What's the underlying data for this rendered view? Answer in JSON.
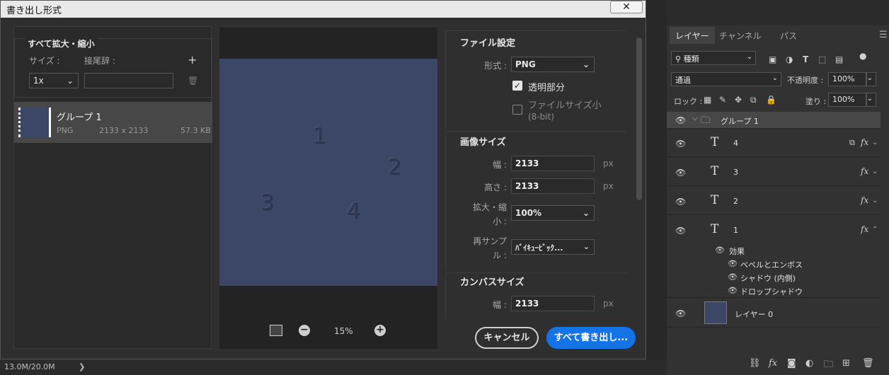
{
  "dialog": {
    "title": "書き出し形式",
    "close": "✕",
    "scale_section": {
      "title": "すべて拡大・縮小",
      "size_label": "サイズ :",
      "suffix_label": "接尾辞 :",
      "add": "+",
      "size_value": "1x"
    },
    "asset": {
      "name": "グループ 1",
      "format": "PNG",
      "dimensions": "2133 x 2133",
      "filesize": "57.3 KB"
    },
    "preview": {
      "numbers": [
        "1",
        "2",
        "3",
        "4"
      ],
      "zoom": "15%",
      "zoom_out": "−",
      "zoom_in": "+"
    },
    "file_settings": {
      "title": "ファイル設定",
      "format_label": "形式 :",
      "format_value": "PNG",
      "transparency_label": "透明部分",
      "transparency_checked": true,
      "smaller_file_label": "ファイルサイズ小",
      "smaller_file_sub": "(8-bit)",
      "smaller_file_checked": false
    },
    "image_size": {
      "title": "画像サイズ",
      "width_label": "幅 :",
      "width_value": "2133",
      "height_label": "高さ :",
      "height_value": "2133",
      "unit": "px",
      "scale_label_1": "拡大・縮",
      "scale_label_2": "小 :",
      "scale_value": "100%",
      "resample_label_1": "再サンプ",
      "resample_label_2": "ル :",
      "resample_value": "ﾊﾞｲｷｭｰﾋﾞｯｸ..."
    },
    "canvas_size": {
      "title": "カンバスサイズ",
      "width_label": "幅 :",
      "width_value": "2133",
      "unit": "px"
    },
    "buttons": {
      "cancel": "キャンセル",
      "export": "すべて書き出し..."
    }
  },
  "status": {
    "text": "13.0M/20.0M",
    "arrow": "❯"
  },
  "layers_panel": {
    "tabs": [
      "レイヤー",
      "チャンネル",
      "パス"
    ],
    "filter_label": "種類",
    "blend_mode": "通過",
    "opacity_label": "不透明度 :",
    "opacity_value": "100%",
    "lock_label": "ロック :",
    "fill_label": "塗り :",
    "fill_value": "100%",
    "group_name": "グループ 1",
    "layers": [
      {
        "name": "4",
        "fx": "fx"
      },
      {
        "name": "3",
        "fx": "fx"
      },
      {
        "name": "2",
        "fx": "fx"
      },
      {
        "name": "1",
        "fx": "fx"
      }
    ],
    "effects_title": "効果",
    "effects": [
      "ベベルとエンボス",
      "シャドウ (内側)",
      "ドロップシャドウ"
    ],
    "base_layer": "レイヤー 0",
    "t_glyph": "T",
    "bottom_icons": [
      "link-icon",
      "fx-icon",
      "mask-icon",
      "adjustment-icon",
      "folder-icon",
      "new-layer-icon",
      "trash-icon"
    ],
    "fx_text": "fx"
  },
  "colors": {
    "accent": "#1473e6",
    "canvas": "#3c4768"
  }
}
